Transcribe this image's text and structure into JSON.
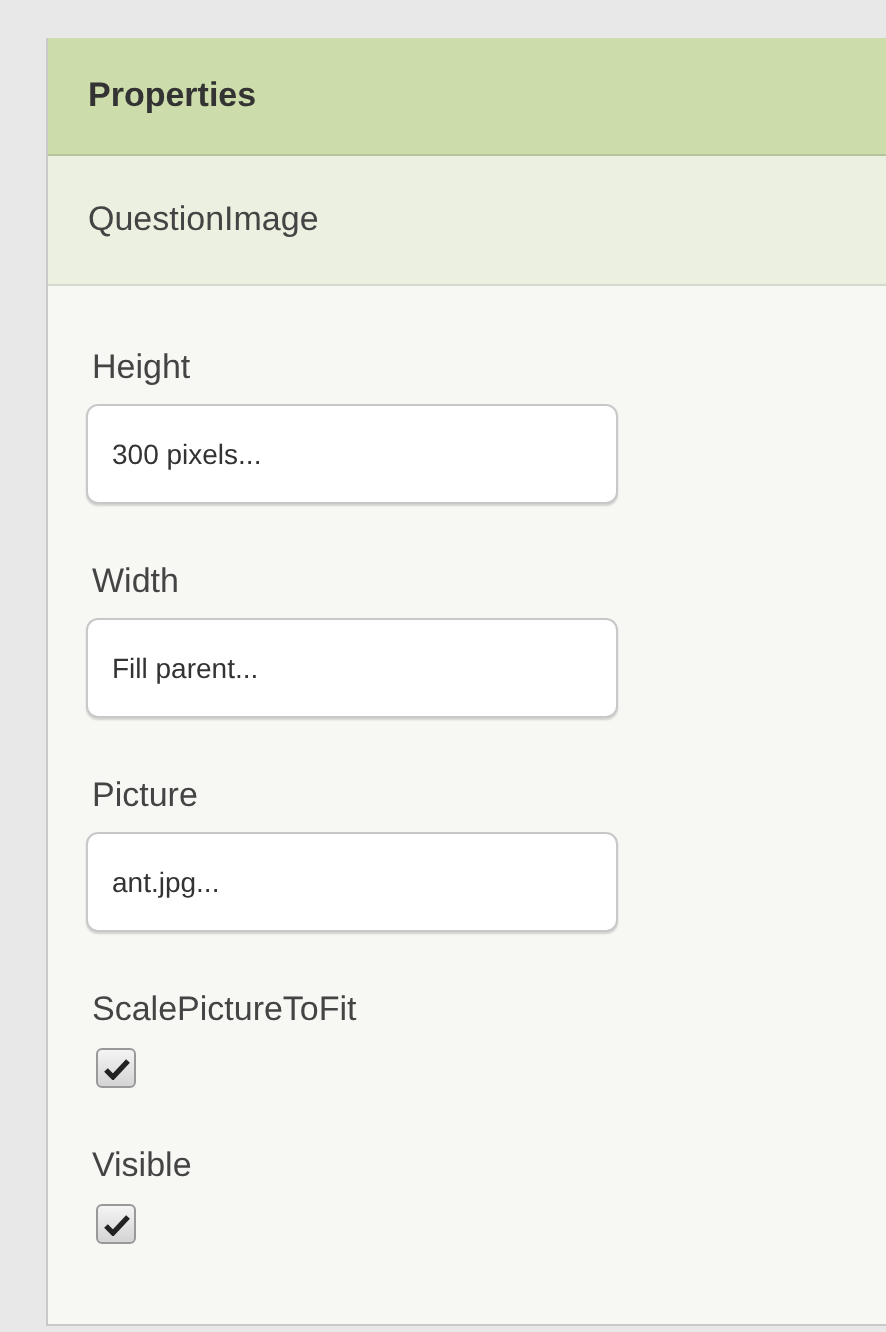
{
  "panel": {
    "title": "Properties",
    "component": "QuestionImage"
  },
  "properties": [
    {
      "kind": "text",
      "label": "Height",
      "value": "300 pixels..."
    },
    {
      "kind": "text",
      "label": "Width",
      "value": "Fill parent..."
    },
    {
      "kind": "text",
      "label": "Picture",
      "value": "ant.jpg..."
    },
    {
      "kind": "checkbox",
      "label": "ScalePictureToFit",
      "checked": true
    },
    {
      "kind": "checkbox",
      "label": "Visible",
      "checked": true
    }
  ]
}
